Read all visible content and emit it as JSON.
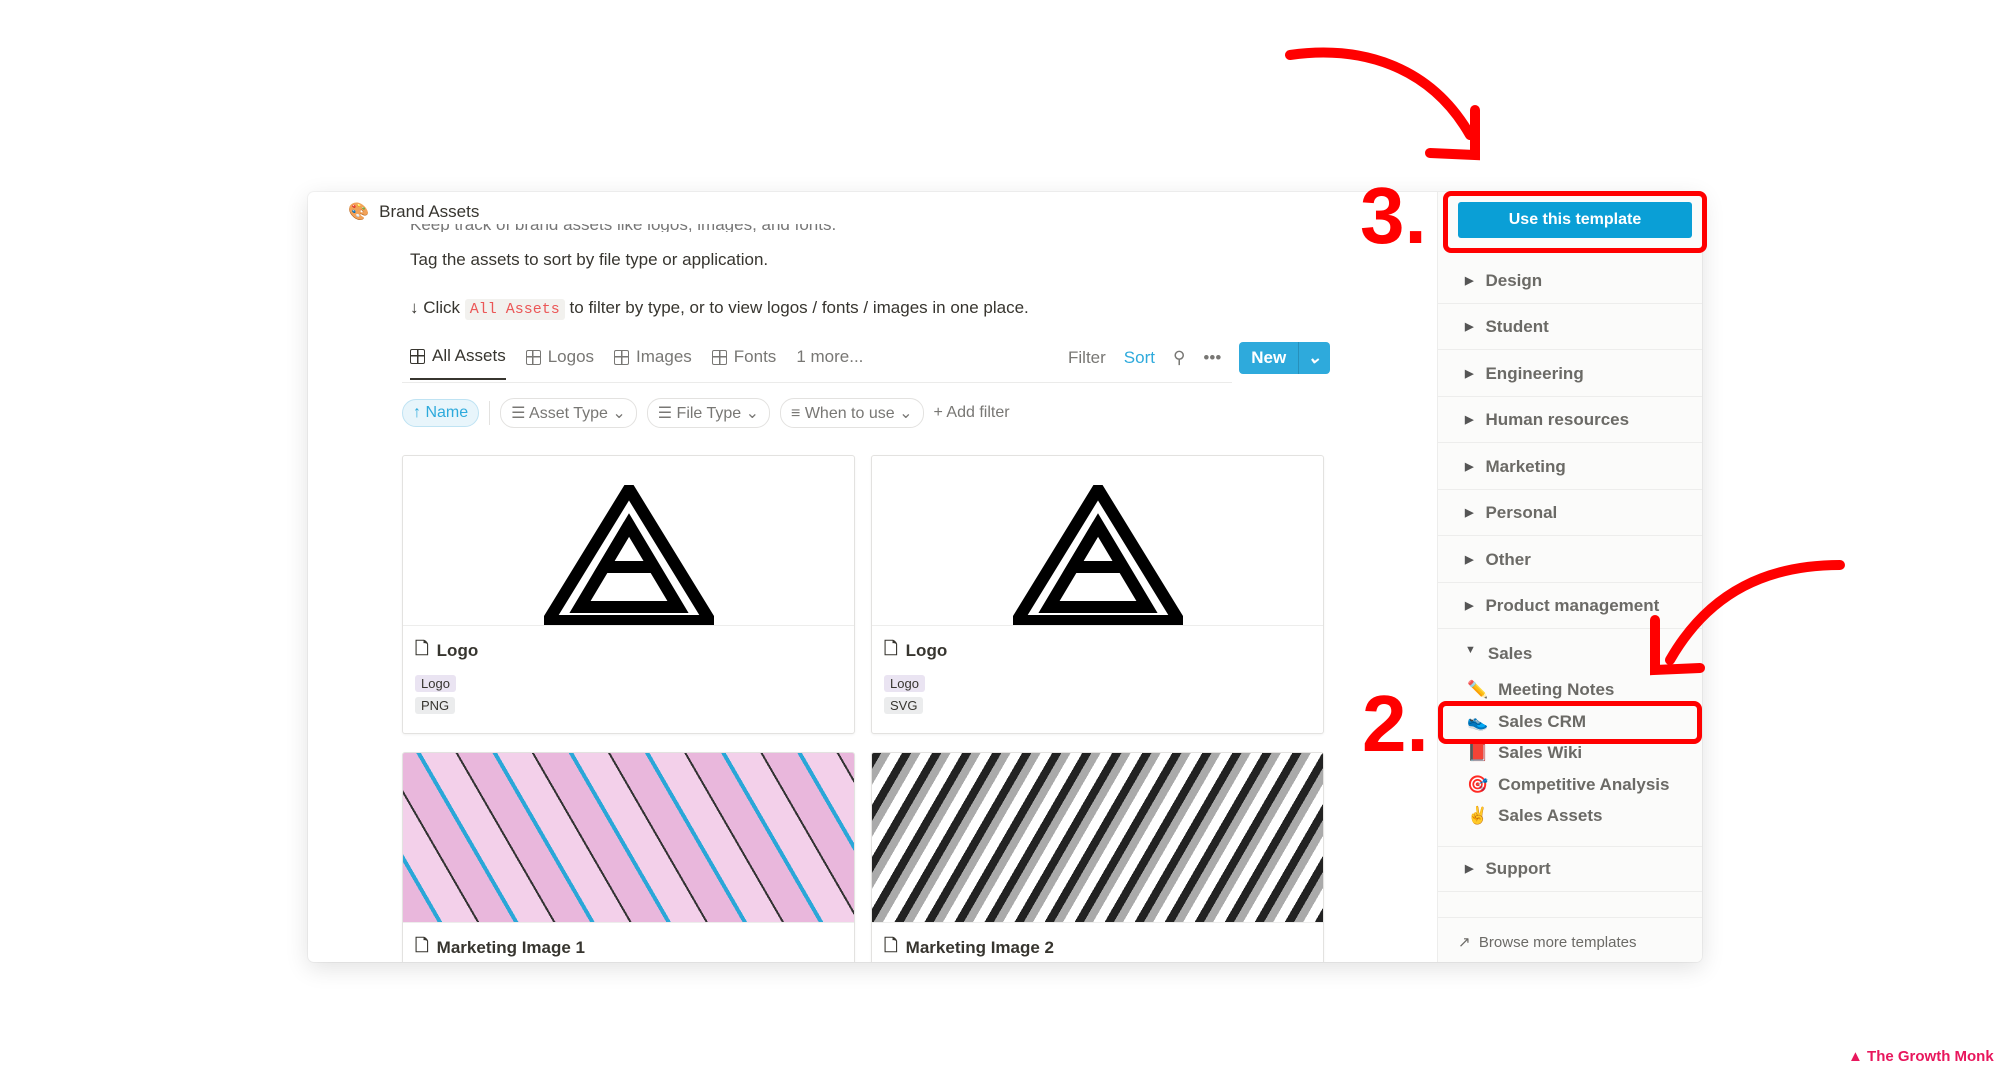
{
  "page": {
    "title": "Brand Assets",
    "icon": "palette-icon",
    "desc_cut": "Keep track of brand assets like logos, images, and fonts.",
    "desc_line2": "Tag the assets to sort by file type or application.",
    "click_prefix": "↓ Click",
    "click_code": "All Assets",
    "click_suffix": "to filter by type, or to view logos / fonts / images in one place."
  },
  "tabs": [
    {
      "label": "All Assets"
    },
    {
      "label": "Logos"
    },
    {
      "label": "Images"
    },
    {
      "label": "Fonts"
    }
  ],
  "tabs_more": "1 more...",
  "actions": {
    "filter": "Filter",
    "sort": "Sort",
    "new": "New"
  },
  "filters": {
    "sort": "↑ Name",
    "items": [
      "Asset Type",
      "File Type",
      "When to use"
    ],
    "add": "Add filter"
  },
  "cards": [
    {
      "name": "Logo",
      "tags": [
        "Logo",
        "PNG"
      ]
    },
    {
      "name": "Logo",
      "tags": [
        "Logo",
        "SVG"
      ]
    },
    {
      "name": "Marketing Image 1",
      "tags": []
    },
    {
      "name": "Marketing Image 2",
      "tags": []
    }
  ],
  "sidebar": {
    "use_template": "Use this template",
    "categories": [
      "Design",
      "Student",
      "Engineering",
      "Human resources",
      "Marketing",
      "Personal",
      "Other",
      "Product management",
      "Sales"
    ],
    "sales_items": [
      {
        "label": "Meeting Notes",
        "icon": "✏️"
      },
      {
        "label": "Sales CRM",
        "icon": "👟"
      },
      {
        "label": "Sales Wiki",
        "icon": "📕"
      },
      {
        "label": "Competitive Analysis",
        "icon": "🎯"
      },
      {
        "label": "Sales Assets",
        "icon": "✌️"
      }
    ],
    "support": "Support",
    "browse": "Browse more templates"
  },
  "annotations": {
    "step3": "3.",
    "step2": "2.",
    "color": "#ff0000"
  },
  "watermark": "The Growth Monk",
  "colors": {
    "accent": "#2eaadc",
    "template_button": "#0a9fd6"
  }
}
